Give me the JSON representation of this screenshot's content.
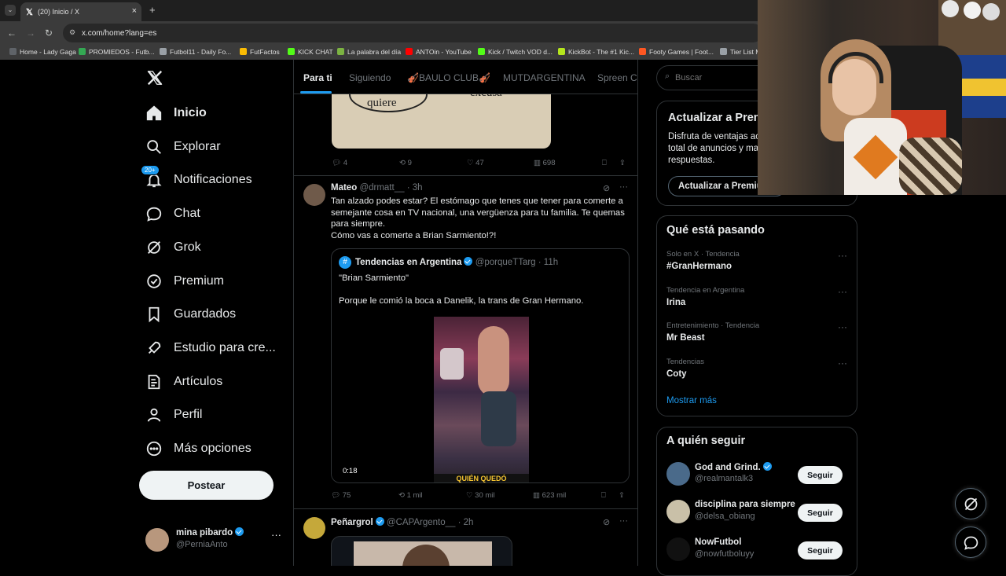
{
  "browser": {
    "tab_title": "(20) Inicio / X",
    "url": "x.com/home?lang=es",
    "bookmarks": [
      {
        "label": "Home - Lady Gaga",
        "color": "#5f6368"
      },
      {
        "label": "PROMIEDOS - Futb...",
        "color": "#34a853"
      },
      {
        "label": "Futbol11 - Daily Fo...",
        "color": "#9aa0a6"
      },
      {
        "label": "FutFactos",
        "color": "#fbbc04"
      },
      {
        "label": "KICK CHAT",
        "color": "#53fc18"
      },
      {
        "label": "La palabra del día",
        "color": "#7cb342"
      },
      {
        "label": "ANTOin - YouTube",
        "color": "#ff0000"
      },
      {
        "label": "Kick / Twitch VOD d...",
        "color": "#53fc18"
      },
      {
        "label": "KickBot - The #1 Kic...",
        "color": "#b5e61d"
      },
      {
        "label": "Footy Games | Foot...",
        "color": "#ff5722"
      },
      {
        "label": "Tier List M",
        "color": "#9aa0a6"
      }
    ]
  },
  "nav": {
    "items": [
      {
        "label": "Inicio",
        "icon": "home-icon"
      },
      {
        "label": "Explorar",
        "icon": "search-icon"
      },
      {
        "label": "Notificaciones",
        "icon": "bell-icon",
        "badge": "20+"
      },
      {
        "label": "Chat",
        "icon": "chat-icon"
      },
      {
        "label": "Grok",
        "icon": "grok-icon"
      },
      {
        "label": "Premium",
        "icon": "premium-icon"
      },
      {
        "label": "Guardados",
        "icon": "bookmark-icon"
      },
      {
        "label": "Estudio para cre...",
        "icon": "rocket-icon"
      },
      {
        "label": "Artículos",
        "icon": "article-icon"
      },
      {
        "label": "Perfil",
        "icon": "person-icon"
      },
      {
        "label": "Más opciones",
        "icon": "more-circle-icon"
      }
    ],
    "post_label": "Postear",
    "account": {
      "name": "mina pibardo",
      "handle": "@PerniaAnto"
    }
  },
  "timeline": {
    "tabs": [
      "Para ti",
      "Siguiendo",
      "🎻BAULO CLUB🎻",
      "MUTDARGENTINA",
      "Spreen Cla"
    ],
    "prev_post": {
      "image_text_1": "quiere",
      "image_text_2": "excusa",
      "stats": {
        "replies": "4",
        "reposts": "9",
        "likes": "47",
        "views": "698"
      }
    },
    "post": {
      "name": "Mateo",
      "handle": "@drmatt__",
      "time": "· 3h",
      "text_lines": [
        "Tan alzado podes estar? El estómago que tenes que tener para comerte a",
        "semejante cosa en TV nacional, una vergüenza para tu familia. Te quemas",
        "para siempre.",
        "Cómo vas a comerte a Brian Sarmiento!?!"
      ],
      "quote": {
        "name": "Tendencias en Argentina",
        "handle": "@porqueTTarg",
        "time": "· 11h",
        "line1": "\"Brian Sarmiento\"",
        "line2": "Porque le comió la boca a Danelik, la trans de Gran Hermano.",
        "video_time": "0:18",
        "video_caption": "QUIÉN QUEDÓ"
      },
      "stats": {
        "replies": "75",
        "reposts": "1 mil",
        "likes": "30 mil",
        "views": "623 mil"
      }
    },
    "next_post": {
      "name": "Peñargrol",
      "handle": "@CAPArgento__",
      "time": "· 2h"
    }
  },
  "sidebar": {
    "search_placeholder": "Buscar",
    "premium": {
      "title": "Actualizar a Prem",
      "desc_lines": [
        "Disfruta de ventajas ac",
        "total de anuncios y ma",
        "respuestas."
      ],
      "button": "Actualizar a Premiu"
    },
    "trends_title": "Qué está pasando",
    "trends": [
      {
        "category": "Solo en X · Tendencia",
        "name": "#GranHermano"
      },
      {
        "category": "Tendencia en Argentina",
        "name": "Irina"
      },
      {
        "category": "Entretenimiento · Tendencia",
        "name": "Mr Beast"
      },
      {
        "category": "Tendencias",
        "name": "Coty"
      }
    ],
    "show_more": "Mostrar más",
    "who_title": "A quién seguir",
    "who": [
      {
        "name": "God and Grind.",
        "handle": "@realmantalk3",
        "verified": true
      },
      {
        "name": "disciplina para siempre",
        "handle": "@delsa_obiang",
        "verified": false
      },
      {
        "name": "NowFutbol",
        "handle": "@nowfutboluyy",
        "verified": false
      }
    ],
    "follow_label": "Seguir"
  },
  "colors": {
    "accent": "#1d9bf0",
    "background": "#000000",
    "border": "#2f3336",
    "muted": "#71767b"
  }
}
